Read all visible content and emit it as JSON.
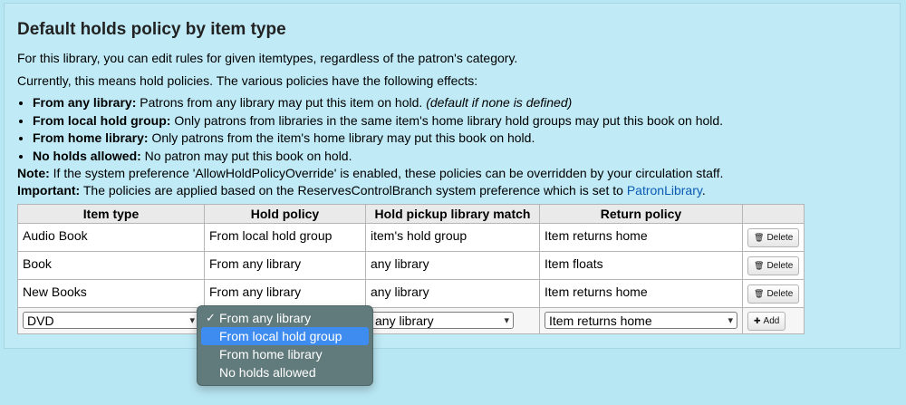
{
  "heading": "Default holds policy by item type",
  "intro": "For this library, you can edit rules for given itemtypes, regardless of the patron's category.",
  "currently": "Currently, this means hold policies. The various policies have the following effects:",
  "effects": [
    {
      "term": "From any library:",
      "text": " Patrons from any library may put this item on hold. ",
      "extra": "(default if none is defined)"
    },
    {
      "term": "From local hold group:",
      "text": " Only patrons from libraries in the same item's home library hold groups may put this book on hold."
    },
    {
      "term": "From home library:",
      "text": " Only patrons from the item's home library may put this book on hold."
    },
    {
      "term": "No holds allowed:",
      "text": " No patron may put this book on hold."
    }
  ],
  "note": {
    "label": "Note:",
    "text": " If the system preference 'AllowHoldPolicyOverride' is enabled, these policies can be overridden by your circulation staff."
  },
  "important": {
    "label": "Important:",
    "text": " The policies are applied based on the ReservesControlBranch system preference which is set to ",
    "link": "PatronLibrary",
    "after": "."
  },
  "table": {
    "headers": [
      "Item type",
      "Hold policy",
      "Hold pickup library match",
      "Return policy",
      ""
    ],
    "rows": [
      {
        "item_type": "Audio Book",
        "hold_policy": "From local hold group",
        "pickup_match": "item's hold group",
        "return_policy": "Item returns home",
        "action": "Delete"
      },
      {
        "item_type": "Book",
        "hold_policy": "From any library",
        "pickup_match": "any library",
        "return_policy": "Item floats",
        "action": "Delete"
      },
      {
        "item_type": "New Books",
        "hold_policy": "From any library",
        "pickup_match": "any library",
        "return_policy": "Item returns home",
        "action": "Delete"
      }
    ],
    "new_row": {
      "item_type": "DVD",
      "pickup_match": "any library",
      "return_policy": "Item returns home",
      "action": "Add"
    }
  },
  "dropdown": {
    "options": [
      "From any library",
      "From local hold group",
      "From home library",
      "No holds allowed"
    ],
    "checked_index": 0,
    "highlighted_index": 1
  },
  "icons": {
    "delete": "trash-icon",
    "add": "plus-icon",
    "select": "chevron-down-icon",
    "checked": "checkmark-icon"
  },
  "colors": {
    "page_bg": "#b8e7f4",
    "link": "#0b5bb5",
    "menu_bg": "#617a7c",
    "menu_highlight": "#3f8cf0"
  }
}
